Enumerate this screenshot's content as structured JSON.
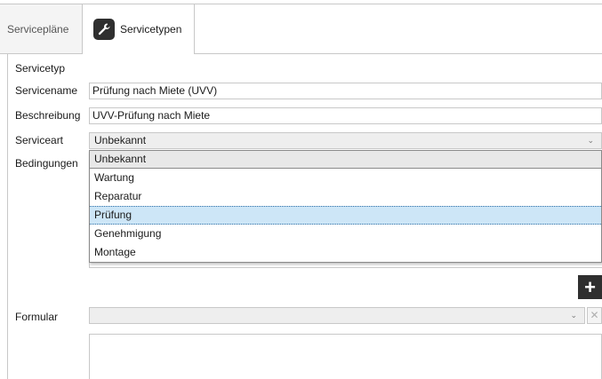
{
  "tabs": [
    {
      "label": "Servicepläne"
    },
    {
      "label": "Servicetypen"
    }
  ],
  "icons": {
    "active_tab": "wrench-icon",
    "add": "plus-icon",
    "clear": "close-icon",
    "dropdown": "chevron-down-icon"
  },
  "colors": {
    "selected_option_bg": "#cde6f7",
    "button_dark": "#2f2f2f"
  },
  "form": {
    "section_label": "Servicetyp",
    "name_label": "Servicename",
    "name_value": "Prüfung nach Miete (UVV)",
    "description_label": "Beschreibung",
    "description_value": "UVV-Prüfung nach Miete",
    "type_label": "Serviceart",
    "type_value": "Unbekannt",
    "conditions_label": "Bedingungen",
    "form_label": "Formular",
    "form_value": ""
  },
  "type_options": [
    "Unbekannt",
    "Wartung",
    "Reparatur",
    "Prüfung",
    "Genehmigung",
    "Montage"
  ],
  "hovered_option": "Prüfung",
  "buttons": {
    "add_symbol": "+",
    "clear_symbol": "✕"
  }
}
